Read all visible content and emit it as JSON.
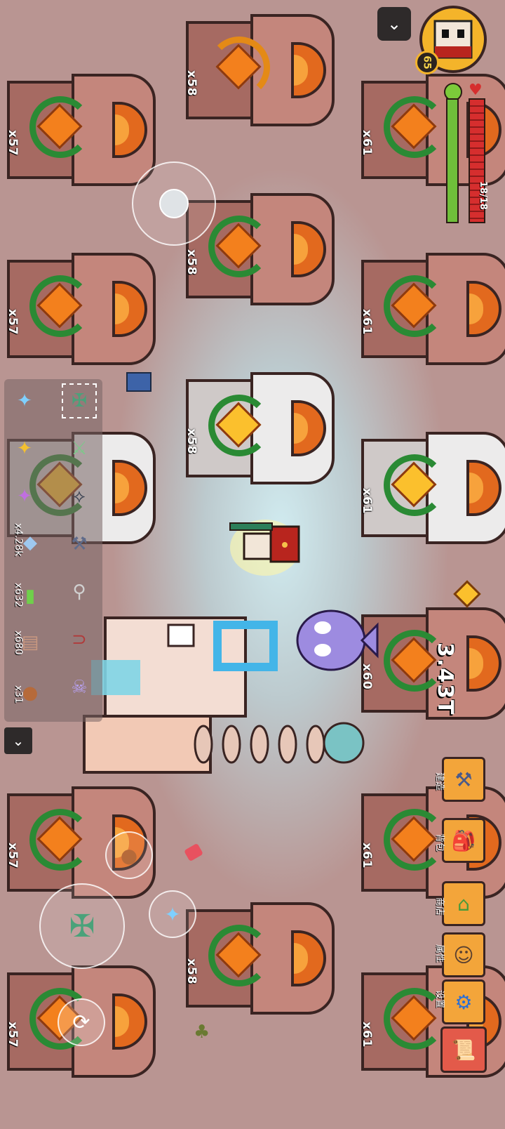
{
  "player": {
    "level": "65",
    "health": "18/18",
    "health_fraction": 1.0,
    "energy_fraction": 1.0
  },
  "currency": {
    "amount": "3.43T"
  },
  "machines": {
    "left_col": [
      {
        "count": "x57"
      },
      {
        "count": "x57"
      },
      {
        "count": "x57"
      },
      {
        "count": "x57"
      }
    ],
    "mid_col": [
      {
        "count": "x58"
      },
      {
        "count": "x58"
      },
      {
        "count": "x58"
      },
      {
        "count": "x58"
      }
    ],
    "right_col": [
      {
        "count": "x61"
      },
      {
        "count": "x61"
      },
      {
        "count": "x61"
      },
      {
        "count": "x60"
      },
      {
        "count": "x61"
      },
      {
        "count": "x61"
      }
    ]
  },
  "inventory": {
    "resources": [
      {
        "icon": "crystal-icon",
        "count": "x4.28k"
      },
      {
        "icon": "battery-icon",
        "count": "x632"
      },
      {
        "icon": "scroll-icon",
        "count": "x680"
      },
      {
        "icon": "meat-icon",
        "count": "x31"
      }
    ]
  },
  "menu": [
    {
      "icon": "anvil-icon",
      "label": "建造"
    },
    {
      "icon": "backpack-icon",
      "label": "背包"
    },
    {
      "icon": "shop-icon",
      "label": "商店"
    },
    {
      "icon": "attribute-icon",
      "label": "属性"
    },
    {
      "icon": "gear-icon",
      "label": "设置"
    }
  ],
  "colors": {
    "accent": "#f3a53a",
    "health": "#d62e2e",
    "energy": "#6fbf3a"
  }
}
